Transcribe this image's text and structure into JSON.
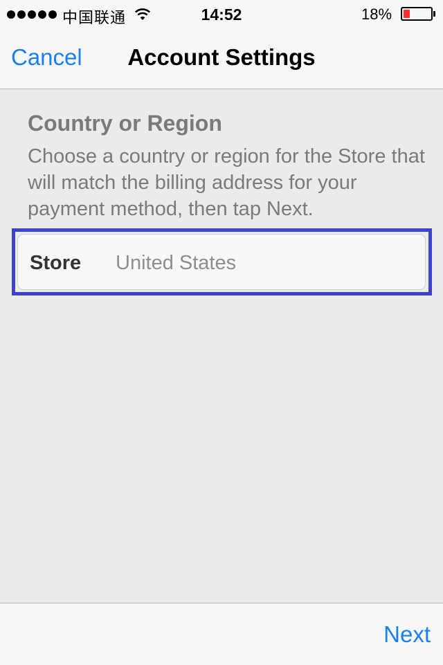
{
  "status_bar": {
    "carrier": "中国联通",
    "time": "14:52",
    "battery_percent": "18%",
    "battery_level": 0.18,
    "signal_bars": 5,
    "wifi_icon": "wifi-icon",
    "battery_color": "#ff2d2d"
  },
  "nav": {
    "cancel_label": "Cancel",
    "title": "Account Settings"
  },
  "section": {
    "title": "Country or Region",
    "description": "Choose a country or region for the Store that will match the billing address for your payment method, then tap Next."
  },
  "store_field": {
    "label": "Store",
    "value": "United States",
    "highlight_color": "#3d44c9"
  },
  "toolbar": {
    "next_label": "Next"
  },
  "colors": {
    "accent": "#1a7ff0",
    "background": "#ebebeb"
  }
}
